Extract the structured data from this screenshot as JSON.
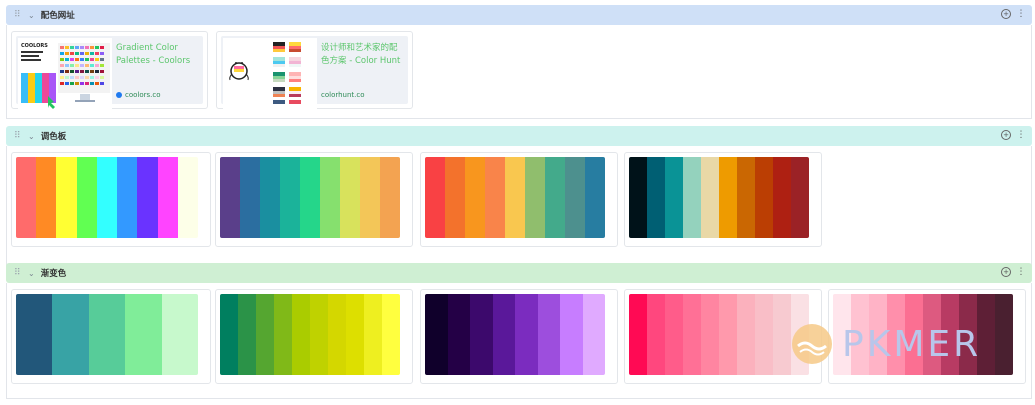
{
  "sections": [
    {
      "title": "配色网址",
      "cards": [
        {
          "title": "Gradient Color Palettes - Coolors",
          "url": "coolors.co"
        },
        {
          "title": "设计师和艺术家的配色方案 - Color Hunt",
          "url": "colorhunt.co"
        }
      ]
    },
    {
      "title": "调色板",
      "palettes": [
        [
          "#ff6b6b",
          "#ff8a24",
          "#ffff33",
          "#61ff52",
          "#33ffff",
          "#3399ff",
          "#6a33ff",
          "#ff44ff",
          "#fdffe8"
        ],
        [
          "#5a3f8a",
          "#2b6ea0",
          "#1a8fa0",
          "#1bb39a",
          "#25d68a",
          "#86e06e",
          "#d8e25c",
          "#f3c658",
          "#f3a351"
        ],
        [
          "#f94144",
          "#f3722c",
          "#f8961e",
          "#f9844a",
          "#f9c74f",
          "#90be6d",
          "#43aa8b",
          "#4d908e",
          "#277da1"
        ],
        [
          "#001219",
          "#005f73",
          "#0a9396",
          "#94d2bd",
          "#e9d8a6",
          "#ee9b00",
          "#ca6702",
          "#bb3e03",
          "#ae2012",
          "#9b2226"
        ]
      ]
    },
    {
      "title": "渐变色",
      "palettes": [
        [
          "#22577a",
          "#38a3a5",
          "#57cc99",
          "#80ed99",
          "#c7f9cc"
        ],
        [
          "#007f5f",
          "#2b9348",
          "#55a630",
          "#80b918",
          "#aacc00",
          "#bfd200",
          "#d4d700",
          "#dddf00",
          "#eeef20",
          "#ffff3f"
        ],
        [
          "#10002b",
          "#240046",
          "#3c096c",
          "#5a189a",
          "#7b2cbf",
          "#9d4edd",
          "#c77dff",
          "#e0aaff"
        ],
        [
          "#ff0a54",
          "#ff477e",
          "#ff5c8a",
          "#ff7096",
          "#ff85a1",
          "#ff99ac",
          "#fbb1bd",
          "#f9bec7",
          "#f7cad0",
          "#fae0e4"
        ],
        [
          "#ffe5ec",
          "#ffc2d1",
          "#ffb3c6",
          "#ff8fab",
          "#fb6f92",
          "#dd5a80",
          "#b83b63",
          "#8b2a4a",
          "#5e1f36",
          "#4a2030"
        ]
      ]
    }
  ],
  "watermark": "PKMER",
  "colors": {
    "section1_header": "#cfe0f7",
    "section2_header": "#cdf2ee",
    "section3_header": "#cfefd3"
  }
}
